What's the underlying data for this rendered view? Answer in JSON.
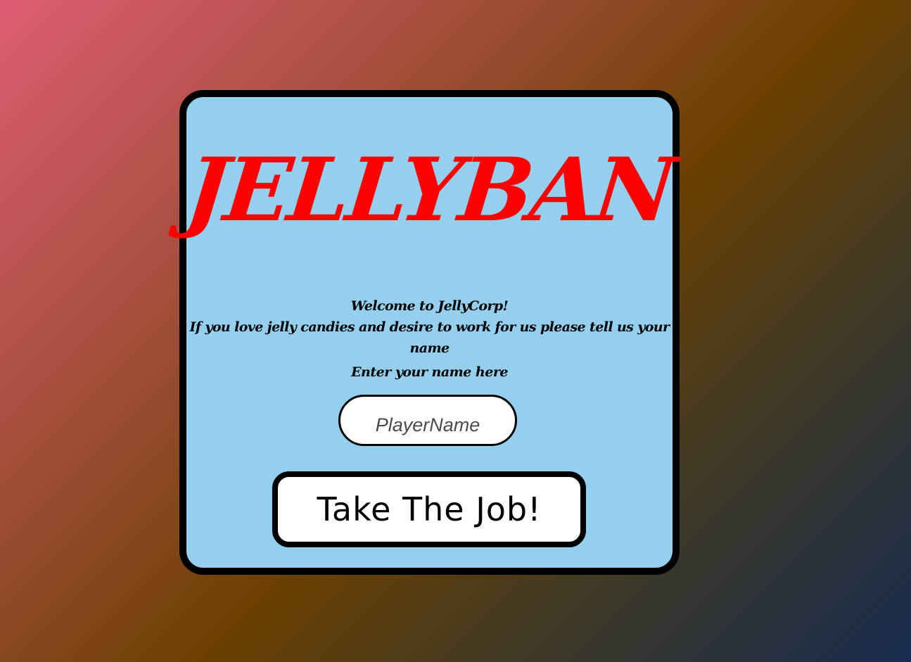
{
  "background": {
    "gradient_colors": [
      "#df5d73",
      "#6a4000",
      "#172b4f"
    ]
  },
  "card": {
    "background_color": "#94cfee",
    "title": "JELLYBAN",
    "title_color": "#ff0000",
    "welcome_line1": "Welcome to  JellyCorp!",
    "welcome_line2": "If you love jelly candies and desire to work for us please tell us your name",
    "enter_label": "Enter your name here",
    "name_input": {
      "value": "",
      "placeholder": "PlayerName"
    },
    "submit_button_label": "Take The Job!"
  }
}
